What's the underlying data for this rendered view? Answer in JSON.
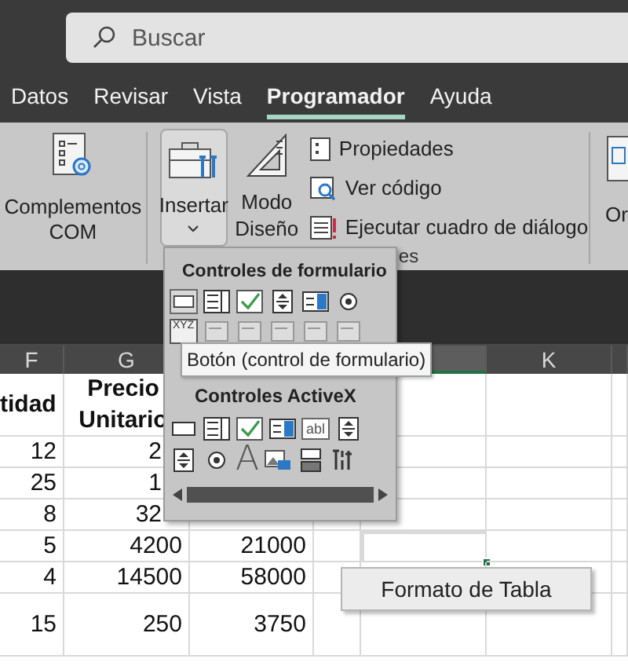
{
  "search": {
    "placeholder": "Buscar"
  },
  "tabs": [
    {
      "label": "Datos",
      "selected": false
    },
    {
      "label": "Revisar",
      "selected": false
    },
    {
      "label": "Vista",
      "selected": false
    },
    {
      "label": "Programador",
      "selected": true
    },
    {
      "label": "Ayuda",
      "selected": false
    }
  ],
  "ribbon": {
    "complementos": {
      "label": "Complementos COM"
    },
    "insertar": {
      "label": "Insertar",
      "expanded": true
    },
    "modo_diseno": {
      "label": "Modo Diseño"
    },
    "items": [
      {
        "label": "Propiedades",
        "kind": "properties"
      },
      {
        "label": "Ver código",
        "kind": "code"
      },
      {
        "label": "Ejecutar cuadro de diálogo",
        "kind": "dialog"
      }
    ],
    "group_label": "es",
    "next_group_label": "Or"
  },
  "columns": [
    {
      "label": "F",
      "selected": false
    },
    {
      "label": "G",
      "selected": false
    },
    {
      "selected": true
    },
    {
      "label": "K",
      "selected": false
    }
  ],
  "rows": [
    {
      "cells": [
        "tidad",
        "Precio Unitario"
      ],
      "active": false
    },
    {
      "cells": [
        "12",
        "2"
      ],
      "active": false
    },
    {
      "cells": [
        "25",
        "1"
      ],
      "active": false
    },
    {
      "cells": [
        "8",
        "32"
      ],
      "active": false
    },
    {
      "cells": [
        "5",
        "4200",
        "21000"
      ],
      "active": true
    },
    {
      "cells": [
        "4",
        "14500",
        "58000"
      ],
      "active": false
    },
    {
      "cells": [
        "15",
        "250",
        "3750"
      ],
      "active": false
    }
  ],
  "sheet_button": {
    "label": "Formato de Tabla"
  },
  "dropdown": {
    "form_title": "Controles de formulario",
    "groupbox_label": "XYZ",
    "activex_title": "Controles ActiveX",
    "label_glyph": "A",
    "textbox_glyph": "abl"
  },
  "tooltip": "Botón (control de formulario)"
}
